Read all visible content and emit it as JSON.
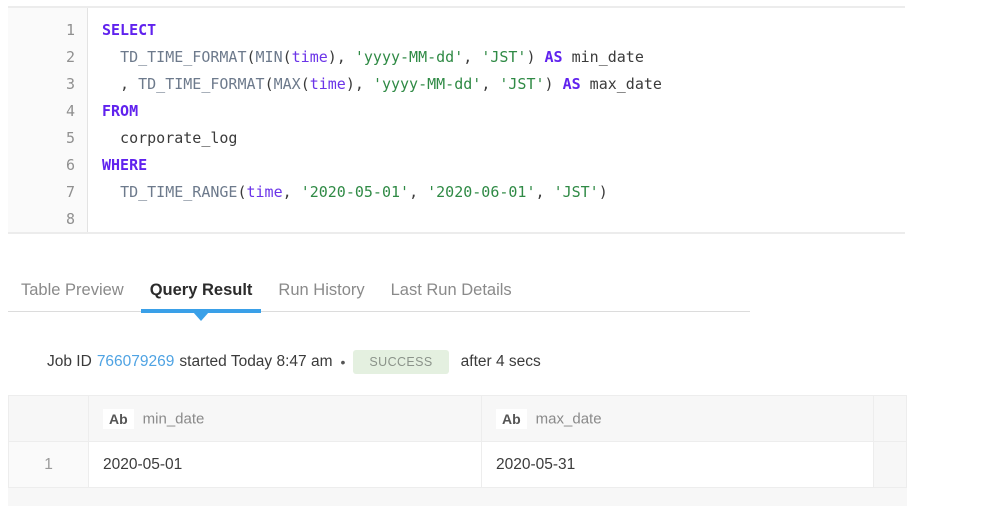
{
  "editor": {
    "gutter_numbers": [
      "1",
      "2",
      "3",
      "4",
      "5",
      "6",
      "7",
      "8"
    ],
    "lines": [
      {
        "n": "1",
        "tokens": [
          {
            "t": "SELECT",
            "c": "kw"
          }
        ]
      },
      {
        "n": "2",
        "tokens": [
          {
            "t": "  ",
            "c": "plain"
          },
          {
            "t": "TD_TIME_FORMAT",
            "c": "fn"
          },
          {
            "t": "(",
            "c": "punct"
          },
          {
            "t": "MIN",
            "c": "fn"
          },
          {
            "t": "(",
            "c": "punct"
          },
          {
            "t": "time",
            "c": "ident"
          },
          {
            "t": "), ",
            "c": "punct"
          },
          {
            "t": "'yyyy-MM-dd'",
            "c": "str"
          },
          {
            "t": ", ",
            "c": "punct"
          },
          {
            "t": "'JST'",
            "c": "str"
          },
          {
            "t": ") ",
            "c": "punct"
          },
          {
            "t": "AS",
            "c": "kw"
          },
          {
            "t": " min_date",
            "c": "plain"
          }
        ]
      },
      {
        "n": "3",
        "tokens": [
          {
            "t": "  , ",
            "c": "plain"
          },
          {
            "t": "TD_TIME_FORMAT",
            "c": "fn"
          },
          {
            "t": "(",
            "c": "punct"
          },
          {
            "t": "MAX",
            "c": "fn"
          },
          {
            "t": "(",
            "c": "punct"
          },
          {
            "t": "time",
            "c": "ident"
          },
          {
            "t": "), ",
            "c": "punct"
          },
          {
            "t": "'yyyy-MM-dd'",
            "c": "str"
          },
          {
            "t": ", ",
            "c": "punct"
          },
          {
            "t": "'JST'",
            "c": "str"
          },
          {
            "t": ") ",
            "c": "punct"
          },
          {
            "t": "AS",
            "c": "kw"
          },
          {
            "t": " max_date",
            "c": "plain"
          }
        ]
      },
      {
        "n": "4",
        "tokens": [
          {
            "t": "FROM",
            "c": "kw"
          }
        ]
      },
      {
        "n": "5",
        "tokens": [
          {
            "t": "  corporate_log",
            "c": "plain"
          }
        ]
      },
      {
        "n": "6",
        "tokens": [
          {
            "t": "WHERE",
            "c": "kw"
          }
        ]
      },
      {
        "n": "7",
        "tokens": [
          {
            "t": "  ",
            "c": "plain"
          },
          {
            "t": "TD_TIME_RANGE",
            "c": "fn"
          },
          {
            "t": "(",
            "c": "punct"
          },
          {
            "t": "time",
            "c": "ident"
          },
          {
            "t": ", ",
            "c": "punct"
          },
          {
            "t": "'2020-05-01'",
            "c": "str"
          },
          {
            "t": ", ",
            "c": "punct"
          },
          {
            "t": "'2020-06-01'",
            "c": "str"
          },
          {
            "t": ", ",
            "c": "punct"
          },
          {
            "t": "'JST'",
            "c": "str"
          },
          {
            "t": ")",
            "c": "punct"
          }
        ]
      },
      {
        "n": "8",
        "tokens": [
          {
            "t": "",
            "c": "plain"
          }
        ]
      }
    ]
  },
  "tabs": [
    {
      "label": "Table Preview",
      "active": false
    },
    {
      "label": "Query Result",
      "active": true
    },
    {
      "label": "Run History",
      "active": false
    },
    {
      "label": "Last Run Details",
      "active": false
    }
  ],
  "job_status": {
    "prefix": "Job ID",
    "job_id": "766079269",
    "started_text": "started Today 8:47 am",
    "separator": "•",
    "status_badge": "SUCCESS",
    "duration_text": "after 4 secs"
  },
  "result": {
    "columns": [
      {
        "type": "Ab",
        "name": "min_date"
      },
      {
        "type": "Ab",
        "name": "max_date"
      }
    ],
    "rows": [
      {
        "index": "1",
        "cells": [
          "2020-05-01",
          "2020-05-31"
        ]
      }
    ]
  },
  "colors": {
    "accent": "#3aa0e8",
    "link": "#4fa3e3",
    "keyword": "#6022ee",
    "string": "#2f8a45",
    "identifier": "#6b34e8",
    "function": "#6d7a8c",
    "badge_bg": "#e4f0e0",
    "badge_text": "#8b938a"
  }
}
